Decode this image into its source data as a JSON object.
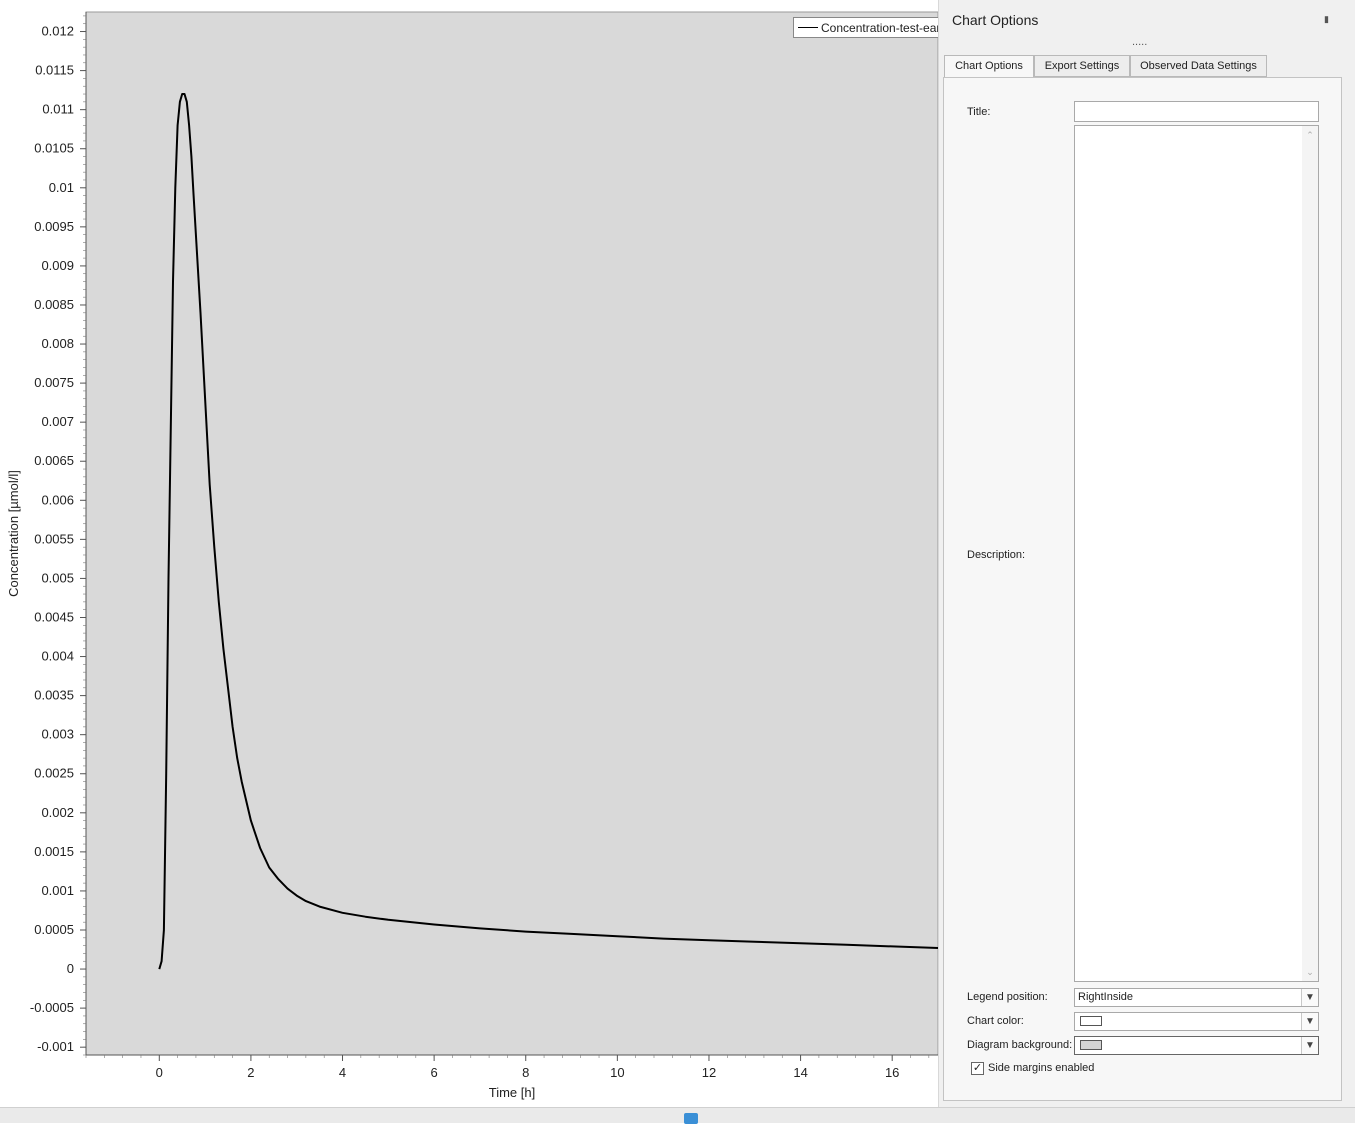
{
  "chart_data": {
    "type": "line",
    "title": "",
    "xlabel": "Time [h]",
    "ylabel": "Concentration [µmol/l]",
    "xlim": [
      -1.6,
      17.0
    ],
    "ylim": [
      -0.0011,
      0.01225
    ],
    "x_ticks": [
      "0",
      "2",
      "4",
      "6",
      "8",
      "10",
      "12",
      "14",
      "16"
    ],
    "y_ticks": [
      "0.012",
      "0.0115",
      "0.011",
      "0.0105",
      "0.01",
      "0.0095",
      "0.009",
      "0.0085",
      "0.008",
      "0.0075",
      "0.007",
      "0.0065",
      "0.006",
      "0.0055",
      "0.005",
      "0.0045",
      "0.004",
      "0.0035",
      "0.003",
      "0.0025",
      "0.002",
      "0.0015",
      "0.001",
      "0.0005",
      "0",
      "-0.0005",
      "-0.001"
    ],
    "background": "#d9d9d9",
    "legend_position": "top-right",
    "series": [
      {
        "name": "Concentration-test-early",
        "color": "#000000",
        "x": [
          0,
          0.05,
          0.1,
          0.15,
          0.2,
          0.3,
          0.35,
          0.4,
          0.45,
          0.5,
          0.55,
          0.6,
          0.65,
          0.7,
          0.75,
          0.8,
          0.9,
          1.0,
          1.1,
          1.2,
          1.3,
          1.4,
          1.5,
          1.6,
          1.7,
          1.8,
          2.0,
          2.2,
          2.4,
          2.6,
          2.8,
          3.0,
          3.2,
          3.5,
          4.0,
          4.5,
          5.0,
          6.0,
          7.0,
          8.0,
          9.0,
          10.0,
          11.0,
          12.0,
          13.0,
          14.0,
          15.0,
          16.0,
          17.0
        ],
        "y": [
          0.0,
          0.0001,
          0.0005,
          0.0025,
          0.005,
          0.0088,
          0.01,
          0.0108,
          0.0111,
          0.0112,
          0.0112,
          0.0111,
          0.0108,
          0.0104,
          0.0099,
          0.0094,
          0.0084,
          0.0073,
          0.0062,
          0.0054,
          0.0047,
          0.0041,
          0.0036,
          0.0031,
          0.0027,
          0.0024,
          0.0019,
          0.00155,
          0.0013,
          0.00115,
          0.00103,
          0.00094,
          0.00087,
          0.0008,
          0.00072,
          0.00067,
          0.00063,
          0.00057,
          0.00052,
          0.00048,
          0.00045,
          0.00042,
          0.00039,
          0.00037,
          0.00035,
          0.00033,
          0.00031,
          0.00029,
          0.00027
        ]
      }
    ]
  },
  "legend": {
    "entry_label": "Concentration-test-early"
  },
  "panel": {
    "title": "Chart Options",
    "grip_text": ".....",
    "tabs": [
      "Chart Options",
      "Export Settings",
      "Observed Data Settings"
    ],
    "fields": {
      "title_label": "Title:",
      "title_value": "",
      "description_label": "Description:",
      "description_value": "",
      "legend_position_label": "Legend position:",
      "legend_position_value": "RightInside",
      "chart_color_label": "Chart color:",
      "chart_color_value": "#ffffff",
      "diagram_background_label": "Diagram background:",
      "diagram_background_value": "#d3d3d3",
      "side_margins_label": "Side margins enabled",
      "side_margins_checked": true
    }
  },
  "icons": {
    "pin": "pin-icon",
    "dropdown": "chevron-down-icon",
    "scroll_up": "chevron-up-icon",
    "scroll_down": "chevron-down-icon",
    "status": "app-status-icon"
  }
}
